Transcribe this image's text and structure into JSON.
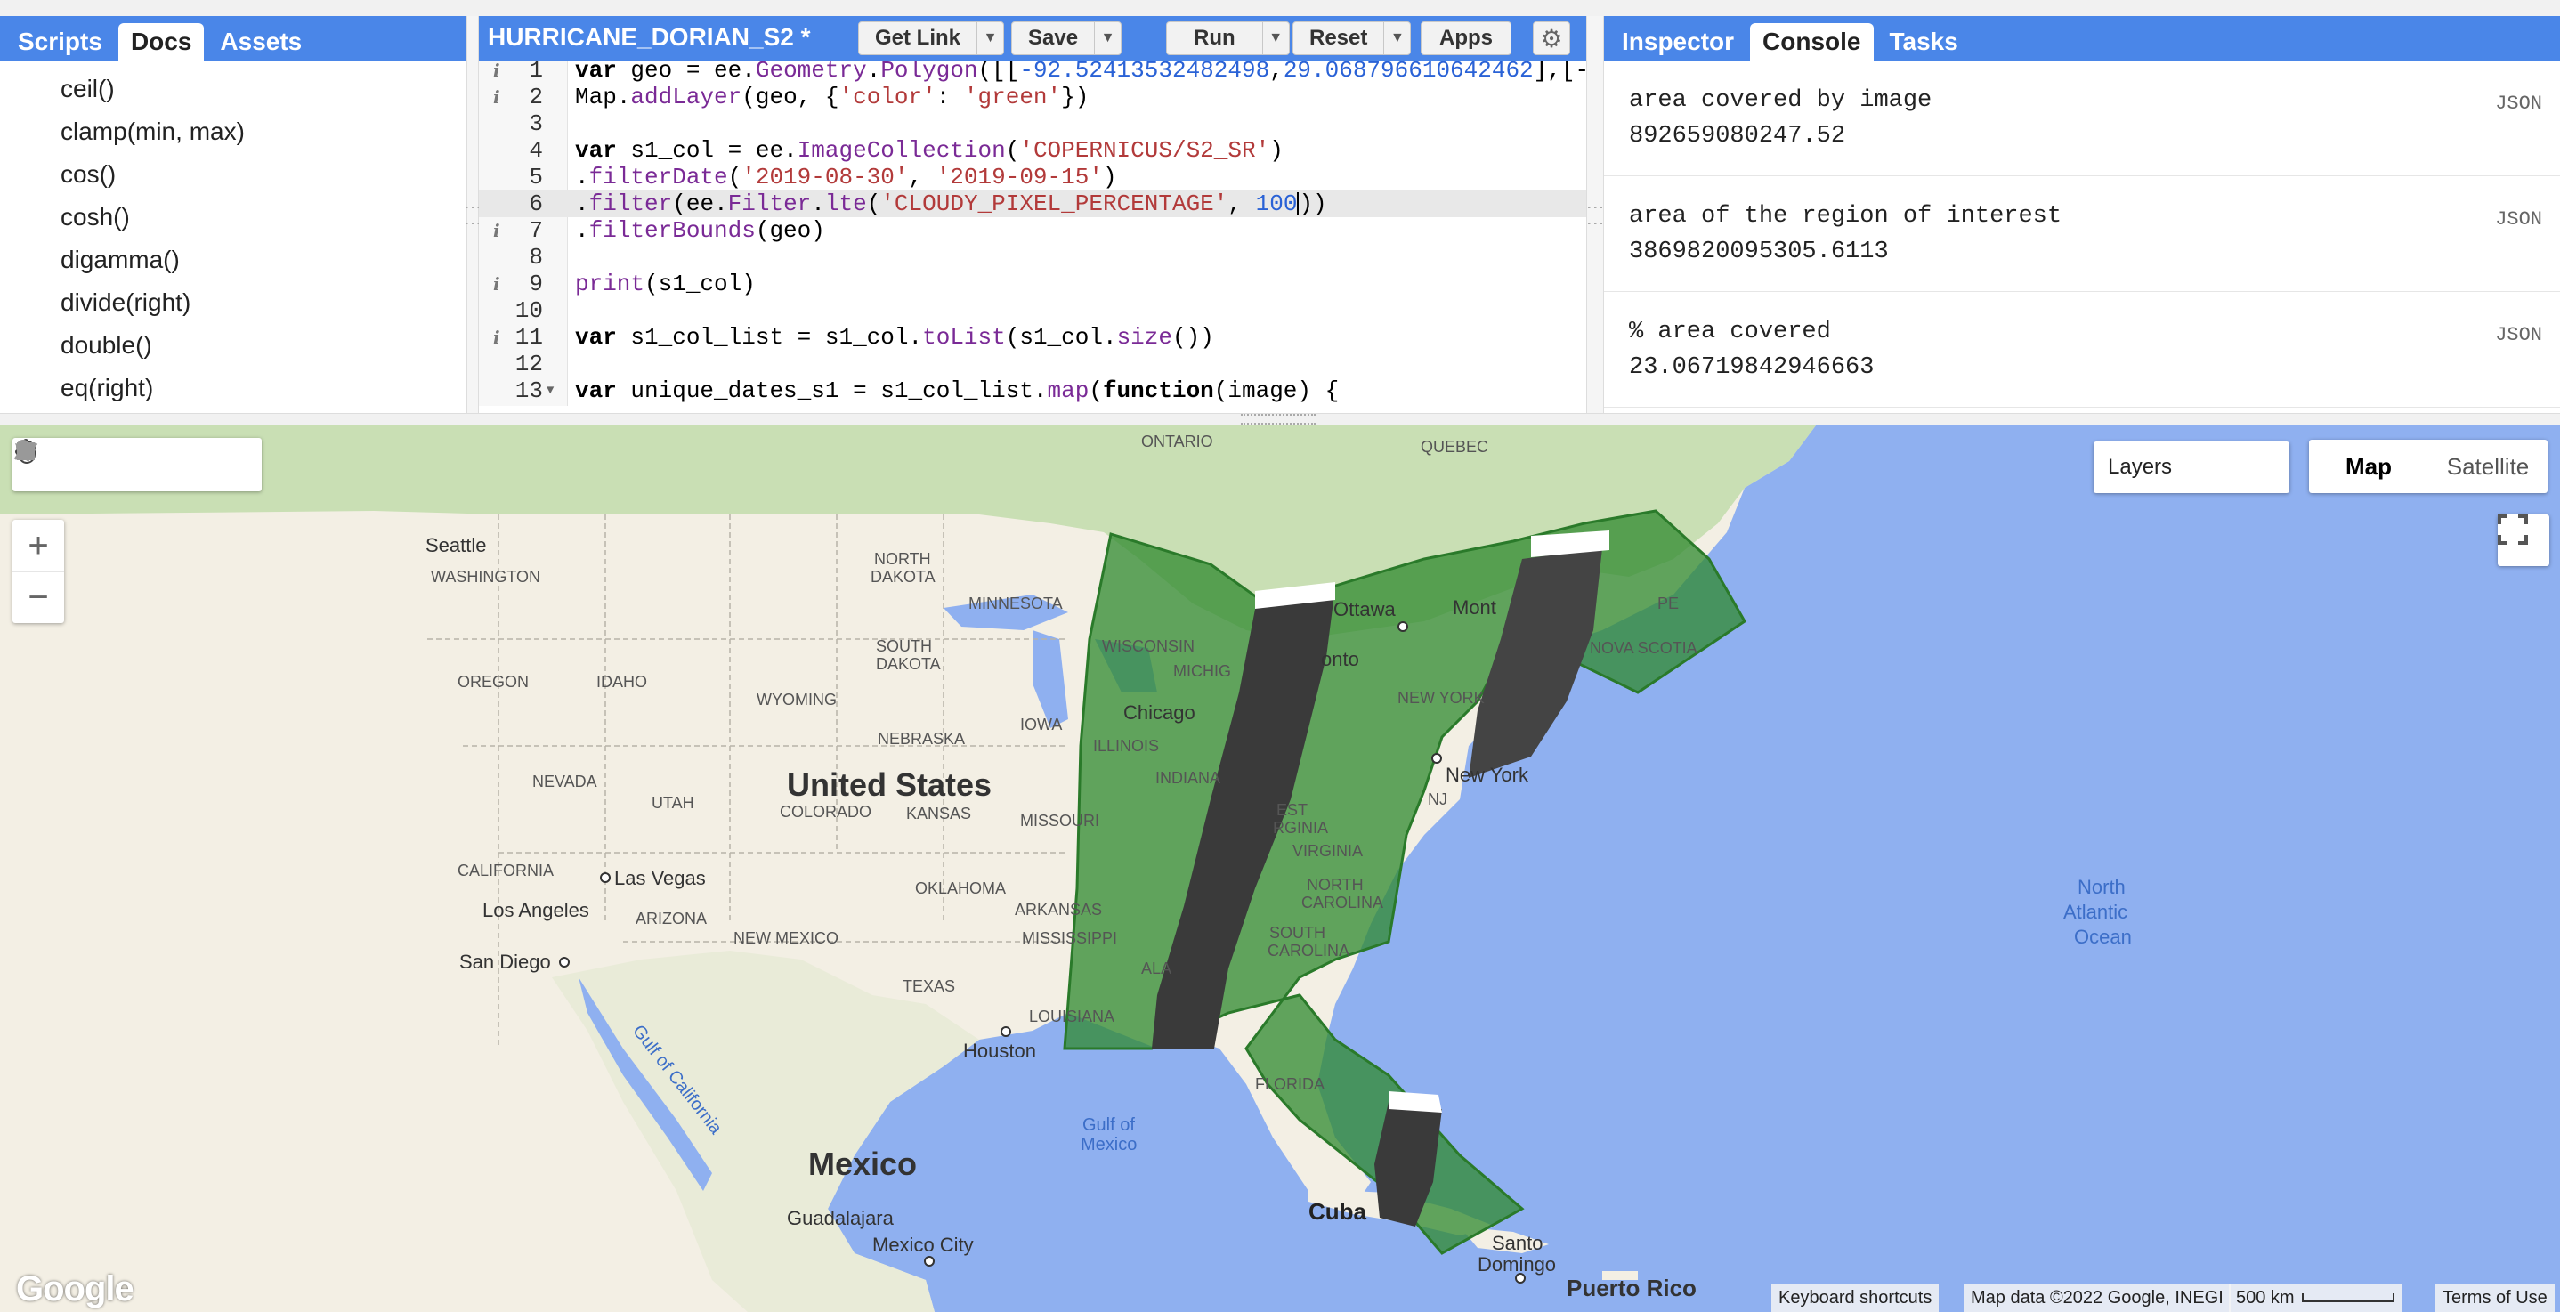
{
  "left_panel": {
    "tabs": [
      "Scripts",
      "Docs",
      "Assets"
    ],
    "active_tab": "Docs",
    "docs": [
      "ceil()",
      "clamp(min, max)",
      "cos()",
      "cosh()",
      "digamma()",
      "divide(right)",
      "double()",
      "eq(right)"
    ]
  },
  "editor": {
    "title": "HURRICANE_DORIAN_S2 *",
    "buttons": {
      "get_link": "Get Link",
      "save": "Save",
      "run": "Run",
      "reset": "Reset",
      "apps": "Apps"
    },
    "lines": [
      {
        "n": "1",
        "info": true,
        "text": "var geo = ee.Geometry.Polygon([[-92.52413532482498,29.068796610642462],[-"
      },
      {
        "n": "2",
        "info": true,
        "text": "Map.addLayer(geo, {'color': 'green'})"
      },
      {
        "n": "3",
        "text": ""
      },
      {
        "n": "4",
        "text": "var s1_col = ee.ImageCollection('COPERNICUS/S2_SR')"
      },
      {
        "n": "5",
        "text": ".filterDate('2019-08-30', '2019-09-15')"
      },
      {
        "n": "6",
        "text": ".filter(ee.Filter.lte('CLOUDY_PIXEL_PERCENTAGE', 100))"
      },
      {
        "n": "7",
        "info": true,
        "text": ".filterBounds(geo)"
      },
      {
        "n": "8",
        "text": ""
      },
      {
        "n": "9",
        "info": true,
        "text": "print(s1_col)"
      },
      {
        "n": "10",
        "text": ""
      },
      {
        "n": "11",
        "info": true,
        "text": "var s1_col_list = s1_col.toList(s1_col.size())"
      },
      {
        "n": "12",
        "text": ""
      },
      {
        "n": "13",
        "fold": true,
        "text": "var unique_dates_s1 = s1_col_list.map(function(image) {"
      }
    ]
  },
  "right_panel": {
    "tabs": [
      "Inspector",
      "Console",
      "Tasks"
    ],
    "active_tab": "Console",
    "console": [
      {
        "label": "area covered by image",
        "value": "892659080247.52",
        "tag": "JSON"
      },
      {
        "label": "area of the region of interest",
        "value": "3869820095305.6113",
        "tag": "JSON"
      },
      {
        "label": "% area covered",
        "value": "23.06719842946663",
        "tag": "JSON"
      }
    ]
  },
  "map": {
    "layers_label": "Layers",
    "map_type": {
      "map": "Map",
      "satellite": "Satellite",
      "active": "Map"
    },
    "zoom_in": "+",
    "zoom_out": "−",
    "google": "Google",
    "attribution": {
      "shortcuts": "Keyboard shortcuts",
      "data": "Map data ©2022 Google, INEGI",
      "scale": "500 km",
      "terms": "Terms of Use"
    },
    "labels": {
      "united_states": "United States",
      "mexico": "Mexico",
      "cuba": "Cuba",
      "ocean_1": "North",
      "ocean_2": "Atlantic",
      "ocean_3": "Ocean",
      "gulf_1": "Gulf of",
      "gulf_2": "Mexico",
      "gulf_cal": "Gulf of California",
      "seattle": "Seattle",
      "washington": "WASHINGTON",
      "oregon": "OREGON",
      "idaho": "IDAHO",
      "wyoming": "WYOMING",
      "nevada": "NEVADA",
      "utah": "UTAH",
      "california": "CALIFORNIA",
      "arizona": "ARIZONA",
      "new_mexico": "NEW MEXICO",
      "colorado": "COLORADO",
      "kansas": "KANSAS",
      "nebraska": "NEBRASKA",
      "south_dakota_1": "SOUTH",
      "south_dakota_2": "DAKOTA",
      "north_dakota_1": "NORTH",
      "north_dakota_2": "DAKOTA",
      "minnesota": "MINNESOTA",
      "iowa": "IOWA",
      "missouri": "MISSOURI",
      "oklahoma": "OKLAHOMA",
      "texas": "TEXAS",
      "arkansas": "ARKANSAS",
      "mississippi": "MISSISSIPPI",
      "louisiana": "LOUISIANA",
      "wisconsin": "WISCONSIN",
      "illinois": "ILLINOIS",
      "indiana": "INDIANA",
      "michigan": "MICHIG",
      "ontario": "ONTARIO",
      "quebec": "QUEBEC",
      "ottawa": "Ottawa",
      "toronto": "onto",
      "montreal": "Mont",
      "new_york_state": "NEW YORK",
      "new_york_city": "New York",
      "west_virginia_1": "EST",
      "west_virginia_2": "RGINIA",
      "virginia": "VIRGINIA",
      "north_carolina_1": "NORTH",
      "north_carolina_2": "CAROLINA",
      "south_carolina_1": "SOUTH",
      "south_carolina_2": "CAROLINA",
      "alabama": "ALA",
      "florida": "FLORIDA",
      "nova_scotia": "NOVA SCOTIA",
      "pe": "PE",
      "nj": "NJ",
      "chicago": "Chicago",
      "houston": "Houston",
      "las_vegas": "Las Vegas",
      "los_angeles": "Los Angeles",
      "san_diego": "San Diego",
      "guadalajara": "Guadalajara",
      "mexico_city": "Mexico City",
      "santo_1": "Santo",
      "santo_2": "Domingo",
      "puerto_rico": "Puerto Rico"
    }
  }
}
